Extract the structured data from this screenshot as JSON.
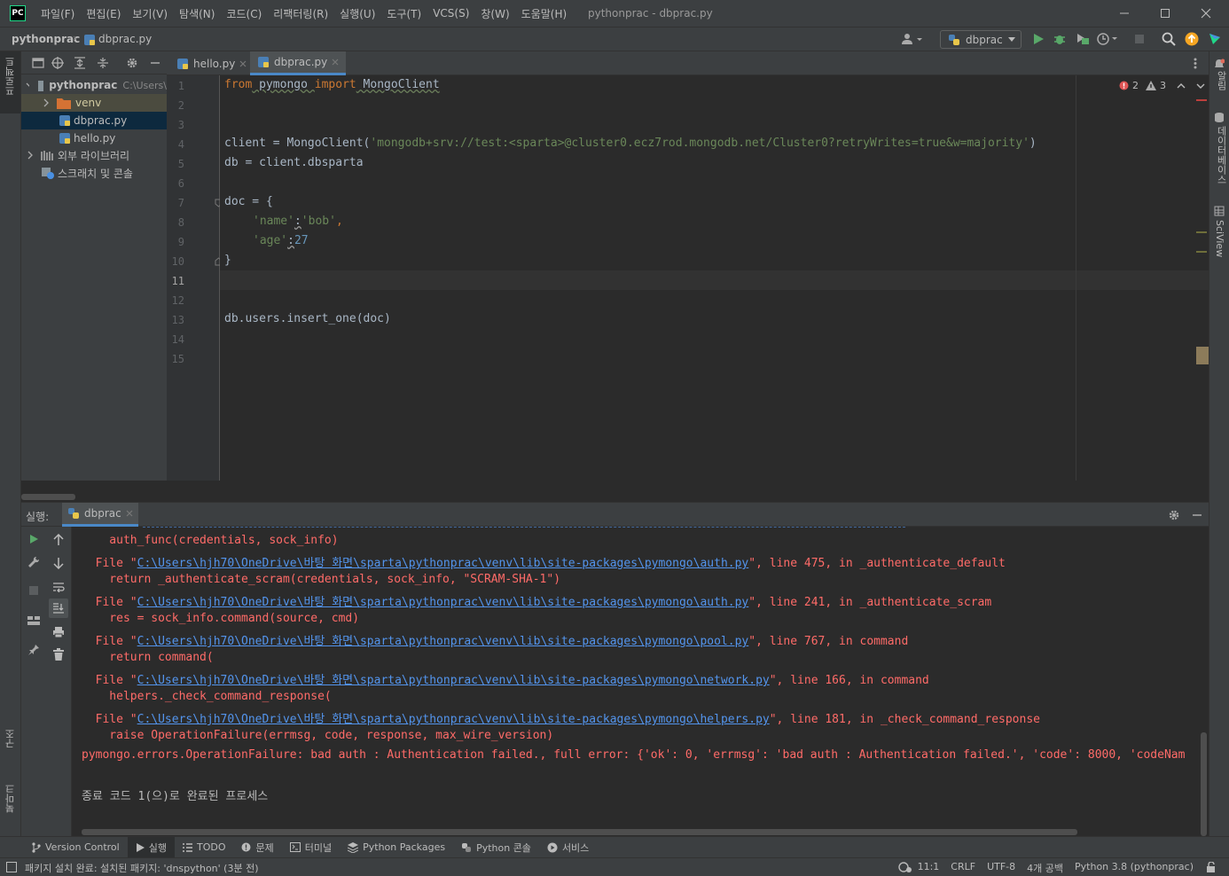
{
  "title_bar": {
    "logo": "PC",
    "menu": [
      "파일(F)",
      "편집(E)",
      "보기(V)",
      "탐색(N)",
      "코드(C)",
      "리팩터링(R)",
      "실행(U)",
      "도구(T)",
      "VCS(S)",
      "창(W)",
      "도움말(H)"
    ],
    "window_title": "pythonprac - dbprac.py"
  },
  "nav_bar": {
    "breadcrumb_project": "pythonprac",
    "breadcrumb_file": "dbprac.py",
    "run_config": "dbprac"
  },
  "left_stripe": {
    "project_label": "프로젝트",
    "structure_label": "구조",
    "bookmarks_label": "북마크"
  },
  "right_stripe": {
    "notifications_label": "알림",
    "database_label": "데이터베이스",
    "sciview_label": "SciView"
  },
  "project_tree": {
    "root_name": "pythonprac",
    "root_path": "C:\\Users\\",
    "items": [
      "venv",
      "dbprac.py",
      "hello.py",
      "외부 라이브러리",
      "스크래치 및 콘솔"
    ]
  },
  "editor": {
    "tabs": [
      "hello.py",
      "dbprac.py"
    ],
    "active_tab": "dbprac.py",
    "line_numbers": [
      "1",
      "2",
      "3",
      "4",
      "5",
      "6",
      "7",
      "8",
      "9",
      "10",
      "11",
      "12",
      "13",
      "14",
      "15"
    ],
    "lines": {
      "l1_kw1": "from",
      "l1_mod": " pymongo ",
      "l1_kw2": "import",
      "l1_name": " MongoClient",
      "l4_pre": "client = MongoClient(",
      "l4_str": "'mongodb+srv://test:<sparta>@cluster0.ecz7rod.mongodb.net/Cluster0?retryWrites=true&w=majority'",
      "l4_post": ")",
      "l5": "db = client.dbsparta",
      "l7": "doc = {",
      "l8_key": "'name'",
      "l8_colon": ":",
      "l8_val": "'bob'",
      "l8_comma": ",",
      "l9_key": "'age'",
      "l9_colon": ":",
      "l9_val": "27",
      "l10": "}",
      "l13": "db.users.insert_one(doc)"
    },
    "inspections": {
      "errors": "2",
      "warnings": "3"
    }
  },
  "run_panel": {
    "label": "실행:",
    "tab": "dbprac",
    "console": [
      {
        "type": "code",
        "text": "    auth_func(credentials, sock_info)"
      },
      {
        "type": "file",
        "pre": "  File \"",
        "link": "C:\\Users\\hjh70\\OneDrive\\바탕 화면\\sparta\\pythonprac\\venv\\lib\\site-packages\\pymongo\\auth.py",
        "post": "\", line 475, in _authenticate_default"
      },
      {
        "type": "code",
        "text": "    return _authenticate_scram(credentials, sock_info, \"SCRAM-SHA-1\")"
      },
      {
        "type": "file",
        "pre": "  File \"",
        "link": "C:\\Users\\hjh70\\OneDrive\\바탕 화면\\sparta\\pythonprac\\venv\\lib\\site-packages\\pymongo\\auth.py",
        "post": "\", line 241, in _authenticate_scram"
      },
      {
        "type": "code",
        "text": "    res = sock_info.command(source, cmd)"
      },
      {
        "type": "file",
        "pre": "  File \"",
        "link": "C:\\Users\\hjh70\\OneDrive\\바탕 화면\\sparta\\pythonprac\\venv\\lib\\site-packages\\pymongo\\pool.py",
        "post": "\", line 767, in command"
      },
      {
        "type": "code",
        "text": "    return command("
      },
      {
        "type": "file",
        "pre": "  File \"",
        "link": "C:\\Users\\hjh70\\OneDrive\\바탕 화면\\sparta\\pythonprac\\venv\\lib\\site-packages\\pymongo\\network.py",
        "post": "\", line 166, in command"
      },
      {
        "type": "code",
        "text": "    helpers._check_command_response("
      },
      {
        "type": "file",
        "pre": "  File \"",
        "link": "C:\\Users\\hjh70\\OneDrive\\바탕 화면\\sparta\\pythonprac\\venv\\lib\\site-packages\\pymongo\\helpers.py",
        "post": "\", line 181, in _check_command_response"
      },
      {
        "type": "code",
        "text": "    raise OperationFailure(errmsg, code, response, max_wire_version)"
      },
      {
        "type": "code",
        "text": "pymongo.errors.OperationFailure: bad auth : Authentication failed., full error: {'ok': 0, 'errmsg': 'bad auth : Authentication failed.', 'code': 8000, 'codeNam"
      }
    ],
    "exit_message": "종료 코드 1(으)로 완료된 프로세스"
  },
  "bottom_tabs": [
    "Version Control",
    "실행",
    "TODO",
    "문제",
    "터미널",
    "Python Packages",
    "Python 콘솔",
    "서비스"
  ],
  "status_bar": {
    "message": "패키지 설치 완료: 설치된 패키지: 'dnspython' (3분 전)",
    "position": "11:1",
    "line_separator": "CRLF",
    "encoding": "UTF-8",
    "indent": "4개 공백",
    "interpreter": "Python 3.8 (pythonprac)"
  },
  "colors": {
    "keyword": "#cc7832",
    "string": "#6a8759",
    "number": "#6897bb",
    "error_text": "#ff6b68",
    "link": "#5394ec"
  }
}
